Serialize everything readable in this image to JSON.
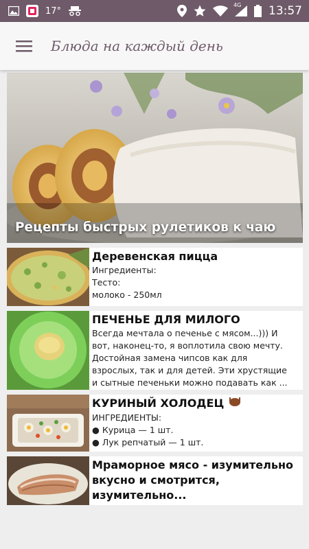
{
  "status_bar": {
    "temperature": "17°",
    "network": "4G",
    "time": "13:57",
    "icons": [
      "gallery-icon",
      "app-notification-icon",
      "incognito-icon",
      "location-icon",
      "star-icon",
      "wifi-icon",
      "signal-icon",
      "battery-icon"
    ]
  },
  "app_bar": {
    "title": "Блюда на каждый день",
    "menu_icon": "hamburger-menu-icon"
  },
  "hero": {
    "caption": "Рецепты быстрых рулетиков к чаю"
  },
  "recipes": [
    {
      "title": "Деревенская пицца",
      "lines": [
        "Ингредиенты:",
        "Тесто:",
        "молоко - 250мл"
      ]
    },
    {
      "title": "ПЕЧЕНЬЕ ДЛЯ МИЛОГО",
      "lines": [
        "Всегда мечтала о печенье с мясом...))) И",
        "вот, наконец-то, я воплотила свою мечту.",
        "Достойная замена чипсов как для",
        "взрослых, так и для детей. Эти хрустящие",
        "и сытные печеньки можно подавать как ..."
      ]
    },
    {
      "title": "КУРИНЫЙ ХОЛОДЕЦ",
      "title_icon": "roast-chicken-icon",
      "lines": [
        "ИНГРЕДИЕНТЫ:",
        "● Курица — 1 шт.",
        "● Лук репчатый — 1 шт."
      ]
    },
    {
      "title": "Мраморное мясо - изумительно вкусно и смотрится, изумительно...",
      "lines": []
    }
  ],
  "colors": {
    "status_bar": "#6e5a68",
    "app_bar": "#f7f7f7",
    "title_color": "#6e5a68",
    "background": "#eeeeee"
  }
}
